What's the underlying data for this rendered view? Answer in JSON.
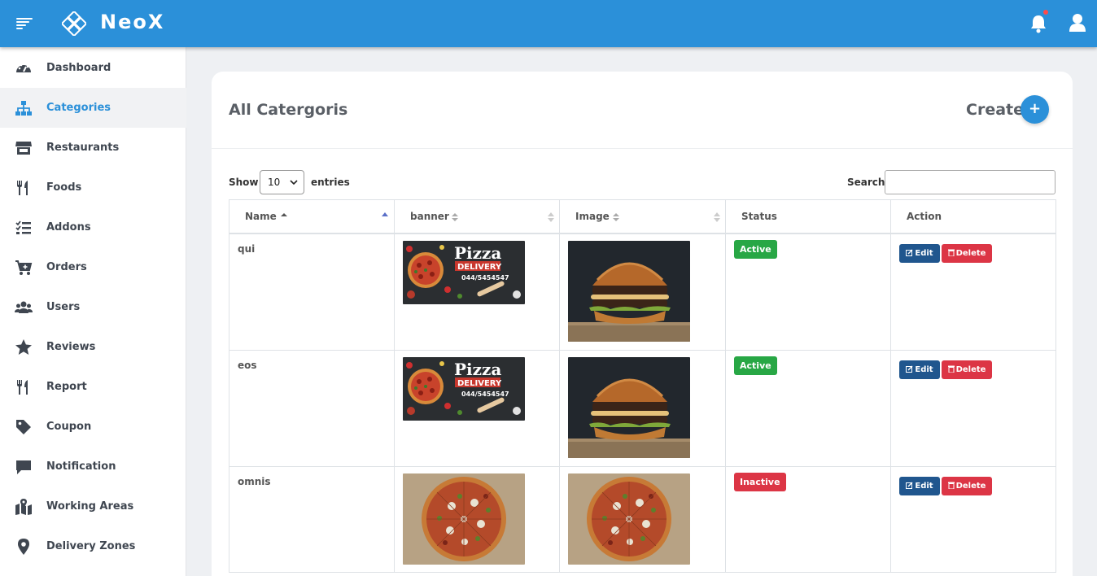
{
  "app": {
    "brand": "NeoX"
  },
  "colors": {
    "primary": "#2b90d9",
    "active_badge": "#28a745",
    "inactive_badge": "#dc3545",
    "edit_button": "#20568e"
  },
  "header": {
    "icons": [
      "menu-toggle-icon",
      "bell-icon",
      "user-icon"
    ]
  },
  "sidebar": {
    "items": [
      {
        "label": "Dashboard",
        "icon": "gauge-icon"
      },
      {
        "label": "Categories",
        "icon": "sitemap-icon",
        "active": true
      },
      {
        "label": "Restaurants",
        "icon": "store-icon"
      },
      {
        "label": "Foods",
        "icon": "utensils-icon"
      },
      {
        "label": "Addons",
        "icon": "tasks-icon"
      },
      {
        "label": "Orders",
        "icon": "cart-plus-icon"
      },
      {
        "label": "Users",
        "icon": "users-icon"
      },
      {
        "label": "Reviews",
        "icon": "star-icon"
      },
      {
        "label": "Report",
        "icon": "utensils-icon"
      },
      {
        "label": "Coupon",
        "icon": "tag-icon"
      },
      {
        "label": "Notification",
        "icon": "comment-icon"
      },
      {
        "label": "Working Areas",
        "icon": "map-marked-icon"
      },
      {
        "label": "Delivery Zones",
        "icon": "map-marker-icon"
      }
    ]
  },
  "page": {
    "title": "All Catergoris",
    "create_label": "Create",
    "create_button": "+"
  },
  "table_controls": {
    "show_label": "Show",
    "entries_value": "10",
    "entries_label": "entries",
    "search_label": "Search:",
    "search_value": ""
  },
  "table": {
    "columns": [
      "Name",
      "banner",
      "Image",
      "Status",
      "Action"
    ],
    "rows": [
      {
        "name": "qui",
        "banner": "pizza-delivery-banner",
        "image": "burger-photo",
        "status": "Active"
      },
      {
        "name": "eos",
        "banner": "pizza-delivery-banner",
        "image": "burger-photo",
        "status": "Active"
      },
      {
        "name": "omnis",
        "banner": "pizza-photo",
        "image": "pizza-photo",
        "status": "Inactive"
      }
    ],
    "edit_label": "Edit",
    "delete_label": "Delete",
    "banner_text": {
      "title": "Pizza",
      "subtitle": "DELIVERY",
      "phone": "044/5454547"
    }
  }
}
